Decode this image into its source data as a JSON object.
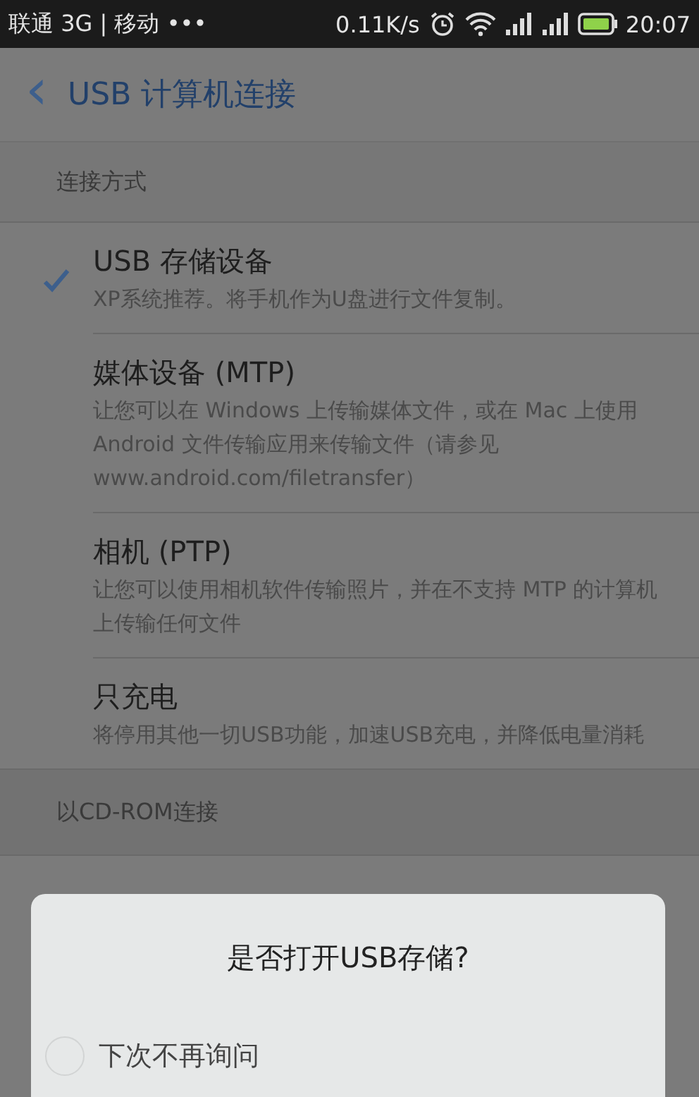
{
  "status_bar": {
    "carrier": "联通 3G | 移动 •••",
    "speed": "0.11K/s",
    "time": "20:07"
  },
  "header": {
    "back": "‹",
    "title": "USB 计算机连接"
  },
  "section": {
    "title": "连接方式"
  },
  "options": [
    {
      "title": "USB 存储设备",
      "description": "XP系统推荐。将手机作为U盘进行文件复制。",
      "selected": true
    },
    {
      "title": "媒体设备 (MTP)",
      "description": "让您可以在 Windows 上传输媒体文件，或在 Mac 上使用 Android 文件传输应用来传输文件（请参见 www.android.com/filetransfer）",
      "selected": false
    },
    {
      "title": "相机 (PTP)",
      "description": "让您可以使用相机软件传输照片，并在不支持 MTP 的计算机上传输任何文件",
      "selected": false
    },
    {
      "title": "只充电",
      "description": "将停用其他一切USB功能，加速USB充电，并降低电量消耗",
      "selected": false
    }
  ],
  "section_2": {
    "title": "以CD-ROM连接"
  },
  "dialog": {
    "title": "是否打开USB存储?",
    "checkbox": {
      "label": "下次不再询问",
      "checked": false
    }
  }
}
